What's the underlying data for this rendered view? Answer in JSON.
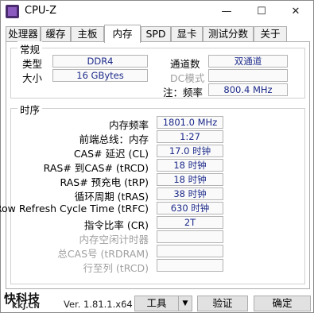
{
  "window": {
    "title": "CPU-Z",
    "minimize": "—",
    "maximize": "☐",
    "close": "✕"
  },
  "tabs": [
    {
      "label": "处理器",
      "active": false
    },
    {
      "label": "缓存",
      "active": false
    },
    {
      "label": "主板",
      "active": false
    },
    {
      "label": "内存",
      "active": true
    },
    {
      "label": "SPD",
      "active": false
    },
    {
      "label": "显卡",
      "active": false
    },
    {
      "label": "测试分数",
      "active": false
    },
    {
      "label": "关于",
      "active": false
    }
  ],
  "general": {
    "title": "常规",
    "type_label": "类型",
    "type_value": "DDR4",
    "channels_label": "通道数",
    "channels_value": "双通道",
    "size_label": "大小",
    "size_value": "16 GBytes",
    "dc_label": "DC模式",
    "dc_value": "",
    "nb_freq_label": "注：频率",
    "nb_freq_value": "800.4 MHz"
  },
  "timings": {
    "title": "时序",
    "rows": [
      {
        "label": "内存频率",
        "value": "1801.0 MHz",
        "dim": false
      },
      {
        "label": "前端总线：内存",
        "value": "1:27",
        "dim": false
      },
      {
        "label": "CAS# 延迟 (CL)",
        "value": "17.0 时钟",
        "dim": false
      },
      {
        "label": "RAS# 到CAS# (tRCD)",
        "value": "18 时钟",
        "dim": false
      },
      {
        "label": "RAS# 预充电 (tRP)",
        "value": "18 时钟",
        "dim": false
      },
      {
        "label": "循环周期 (tRAS)",
        "value": "38 时钟",
        "dim": false
      },
      {
        "label": "Row Refresh Cycle Time (tRFC)",
        "value": "630 时钟",
        "dim": false
      },
      {
        "label": "指令比率 (CR)",
        "value": "2T",
        "dim": false
      },
      {
        "label": "内存空闲计时器",
        "value": "",
        "dim": true
      },
      {
        "label": "总CAS号 (tRDRAM)",
        "value": "",
        "dim": true
      },
      {
        "label": "行至列 (tRCD)",
        "value": "",
        "dim": true
      }
    ]
  },
  "footer": {
    "watermark_logo": "快科技",
    "watermark_sub": "KKJ.CN",
    "version": "Ver. 1.81.1.x64",
    "tools_label": "工具",
    "dropdown_glyph": "▼",
    "validate_label": "验证",
    "ok_label": "确定"
  }
}
